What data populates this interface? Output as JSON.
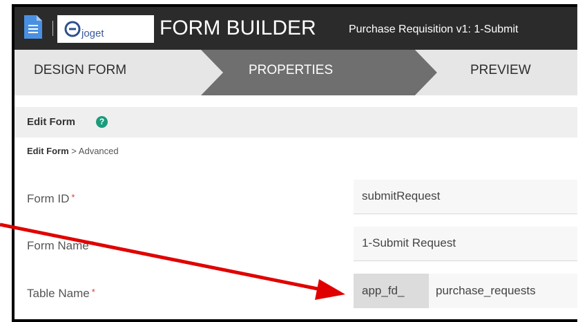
{
  "header": {
    "brand": "joget",
    "title": "FORM BUILDER",
    "subtitle": "Purchase Requisition v1: 1-Submit"
  },
  "steps": [
    {
      "label": "DESIGN FORM",
      "active": false
    },
    {
      "label": "PROPERTIES",
      "active": true
    },
    {
      "label": "PREVIEW",
      "active": false
    }
  ],
  "panel": {
    "title": "Edit Form",
    "help_icon": "?",
    "breadcrumb_root": "Edit Form",
    "breadcrumb_sep": ">",
    "breadcrumb_current": "Advanced"
  },
  "fields": {
    "form_id": {
      "label": "Form ID",
      "required": "*",
      "value": "submitRequest"
    },
    "form_name": {
      "label": "Form Name",
      "required": "*",
      "value": "1-Submit Request"
    },
    "table_name": {
      "label": "Table Name",
      "required": "*",
      "prefix": "app_fd_",
      "value": "purchase_requests"
    }
  },
  "colors": {
    "header_bg": "#2b2b2b",
    "active_step": "#6f6f6f",
    "inactive_step": "#e6e6e6",
    "help_icon": "#1a9c7c",
    "required": "#e53935",
    "annotation_arrow": "#e00000"
  }
}
